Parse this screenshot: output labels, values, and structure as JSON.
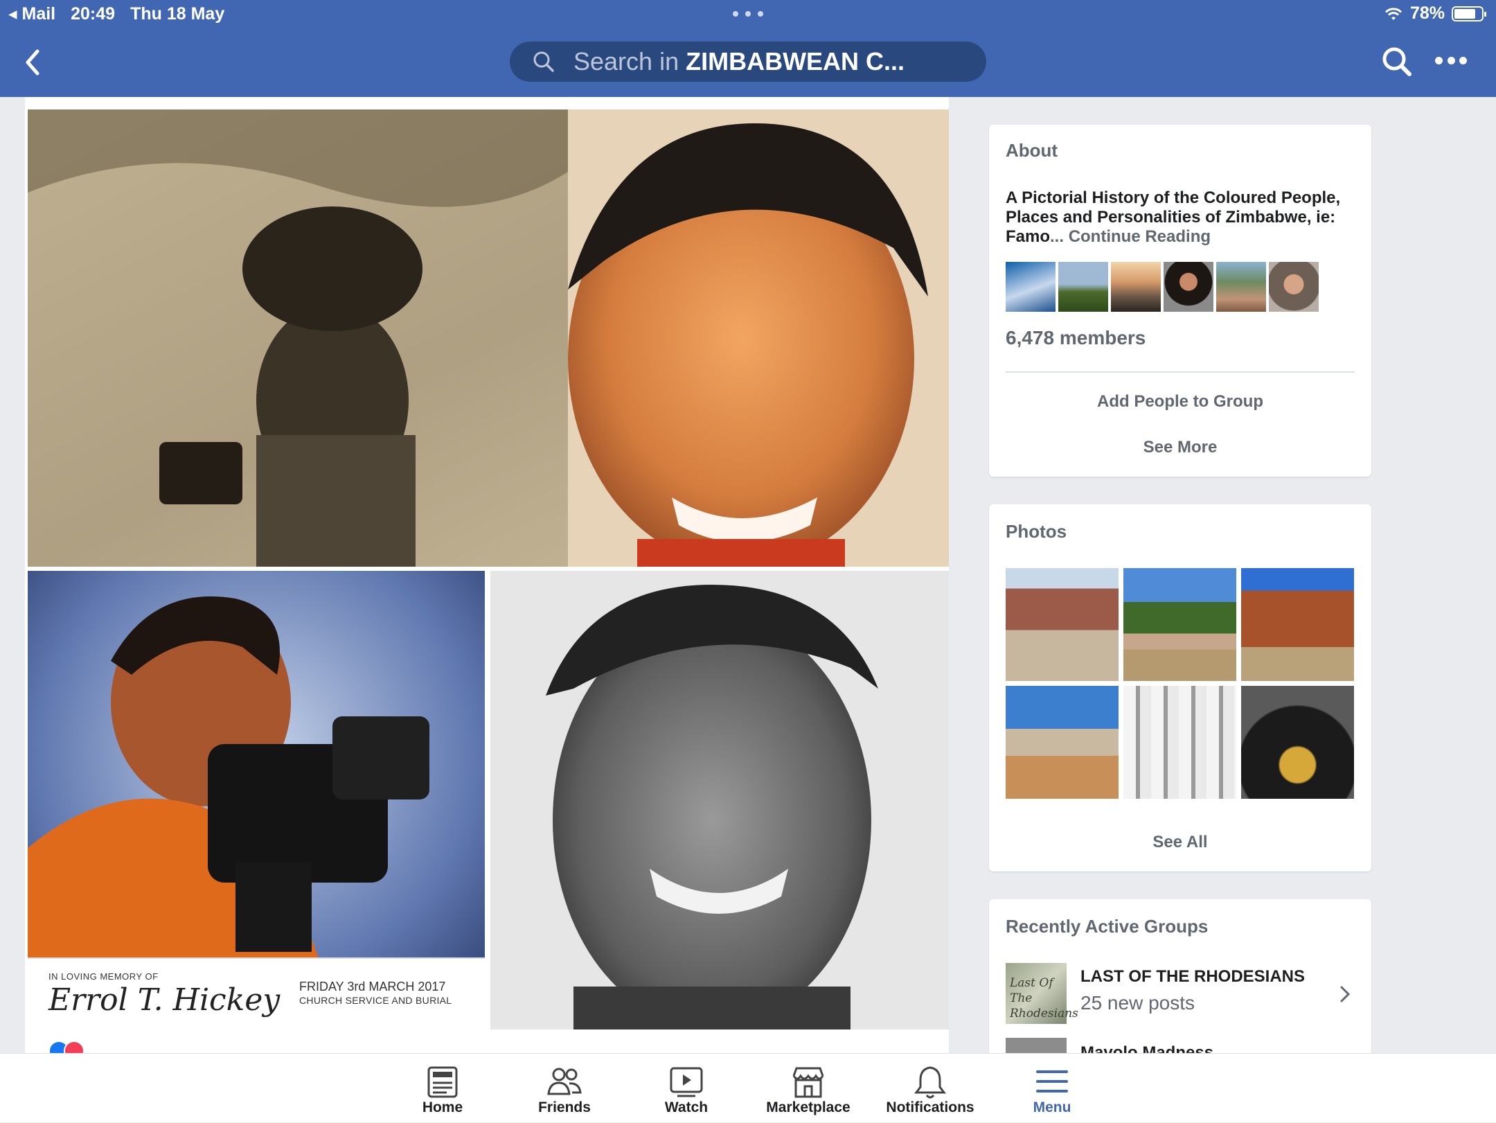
{
  "status_bar": {
    "back_app": "Mail",
    "time": "20:49",
    "date": "Thu 18 May",
    "battery": "78%",
    "battery_level": 0.78
  },
  "nav": {
    "search_prefix": "Search in",
    "search_group": "ZIMBABWEAN C..."
  },
  "post": {
    "memorial_line1": "IN LOVING MEMORY OF",
    "memorial_signature": "Errol T. Hickey",
    "memorial_date": "FRIDAY 3rd MARCH 2017",
    "memorial_service": "CHURCH SERVICE AND BURIAL"
  },
  "about": {
    "heading": "About",
    "description": "A Pictorial History of the Coloured People, Places  and Personalities of Zimbabwe, ie: Famo",
    "continue": "... Continue Reading",
    "members": "6,478 members",
    "add_people": "Add People to Group",
    "see_more": "See More"
  },
  "photos": {
    "heading": "Photos",
    "see_all": "See All"
  },
  "groups": {
    "heading": "Recently Active Groups",
    "items": [
      {
        "name": "LAST OF THE RHODESIANS",
        "sub": "25 new posts",
        "thumb_text": "Last Of The Rhodesians"
      },
      {
        "name": "Mavolo Madness"
      }
    ]
  },
  "tabs": {
    "home": "Home",
    "friends": "Friends",
    "watch": "Watch",
    "marketplace": "Marketplace",
    "notifications": "Notifications",
    "menu": "Menu"
  },
  "colors": {
    "brand": "#4267b2",
    "brand_dark": "#29487d",
    "muted": "#606770",
    "background": "#e9ebee"
  }
}
